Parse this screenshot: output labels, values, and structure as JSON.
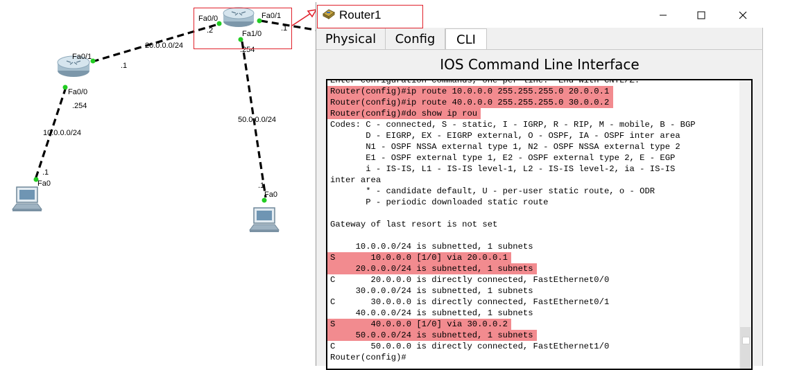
{
  "topology": {
    "labels": {
      "r1_fa00": "Fa0/0",
      "r1_fa01": "Fa0/1",
      "r1_fa10": "Fa1/0",
      "r1_fa00_addr": ".2",
      "r1_fa01_addr": ".1",
      "r1_fa10_addr": ".254",
      "net_20": "20.0.0.0/24",
      "r2_fa01": "Fa0/1",
      "r2_fa01_addr": ".1",
      "r2_fa00": "Fa0/0",
      "r2_fa00_addr": ".254",
      "net_10": "10.0.0.0/24",
      "pc1_addr": ".1",
      "pc1_fa0": "Fa0",
      "net_50": "50.0.0.0/24",
      "pc2_addr": ".1",
      "pc2_fa0": "Fa0"
    },
    "colors": {
      "link_dot": "#22cc22",
      "highlight": "#e0202a"
    }
  },
  "window": {
    "title": "Router1",
    "title_icon": "router-icon",
    "minimize": "—",
    "maximize": "☐",
    "close": "✕",
    "tabs": [
      "Physical",
      "Config",
      "CLI"
    ],
    "active_tab": "CLI",
    "heading": "IOS Command Line Interface"
  },
  "cli": {
    "lines": [
      {
        "text": "Enter configuration commands, one per line.  End with CNTL/Z.",
        "highlight": false
      },
      {
        "text": "Router(config)#ip route 10.0.0.0 255.255.255.0 20.0.0.1",
        "highlight": true
      },
      {
        "text": "Router(config)#ip route 40.0.0.0 255.255.255.0 30.0.0.2",
        "highlight": true
      },
      {
        "text": "Router(config)#do show ip rou",
        "highlight": true
      },
      {
        "text": "Codes: C - connected, S - static, I - IGRP, R - RIP, M - mobile, B - BGP",
        "highlight": false
      },
      {
        "text": "       D - EIGRP, EX - EIGRP external, O - OSPF, IA - OSPF inter area",
        "highlight": false
      },
      {
        "text": "       N1 - OSPF NSSA external type 1, N2 - OSPF NSSA external type 2",
        "highlight": false
      },
      {
        "text": "       E1 - OSPF external type 1, E2 - OSPF external type 2, E - EGP",
        "highlight": false
      },
      {
        "text": "       i - IS-IS, L1 - IS-IS level-1, L2 - IS-IS level-2, ia - IS-IS",
        "highlight": false
      },
      {
        "text": "inter area",
        "highlight": false
      },
      {
        "text": "       * - candidate default, U - per-user static route, o - ODR",
        "highlight": false
      },
      {
        "text": "       P - periodic downloaded static route",
        "highlight": false
      },
      {
        "text": "",
        "highlight": false
      },
      {
        "text": "Gateway of last resort is not set",
        "highlight": false
      },
      {
        "text": "",
        "highlight": false
      },
      {
        "text": "     10.0.0.0/24 is subnetted, 1 subnets",
        "highlight": false
      },
      {
        "text": "S       10.0.0.0 [1/0] via 20.0.0.1",
        "highlight": true
      },
      {
        "text": "     20.0.0.0/24 is subnetted, 1 subnets",
        "highlight": true
      },
      {
        "text": "C       20.0.0.0 is directly connected, FastEthernet0/0",
        "highlight": false
      },
      {
        "text": "     30.0.0.0/24 is subnetted, 1 subnets",
        "highlight": false
      },
      {
        "text": "C       30.0.0.0 is directly connected, FastEthernet0/1",
        "highlight": false
      },
      {
        "text": "     40.0.0.0/24 is subnetted, 1 subnets",
        "highlight": false
      },
      {
        "text": "S       40.0.0.0 [1/0] via 30.0.0.2",
        "highlight": true
      },
      {
        "text": "     50.0.0.0/24 is subnetted, 1 subnets",
        "highlight": true
      },
      {
        "text": "C       50.0.0.0 is directly connected, FastEthernet1/0",
        "highlight": false
      },
      {
        "text": "Router(config)#",
        "highlight": false
      }
    ],
    "highlight_color": "#f28b8f"
  }
}
